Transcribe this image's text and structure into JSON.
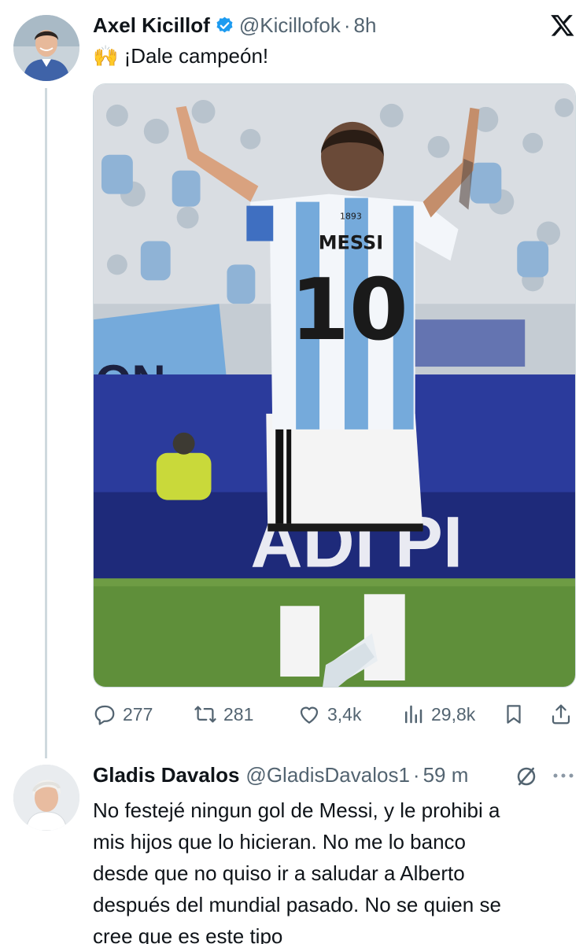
{
  "tweet": {
    "author_name": "Axel Kicillof",
    "author_handle": "@Kicillofok",
    "separator": "·",
    "time": "8h",
    "emoji": "🙌",
    "text": "¡Dale campeón!",
    "media": {
      "jersey_name": "MESSI",
      "jersey_number": "10",
      "jersey_year": "1893",
      "banner_text": "ON",
      "board_text": "ADI PI",
      "colors": {
        "sky_blue": "#75aadb",
        "pitch_green": "#5f8f3a",
        "board_blue": "#2b3b9c"
      }
    },
    "actions": {
      "replies": "277",
      "reposts": "281",
      "likes": "3,4k",
      "views": "29,8k"
    }
  },
  "reply": {
    "author_name": "Gladis Davalos",
    "author_handle": "@GladisDavalos1",
    "separator": "·",
    "time": "59 m",
    "lines": [
      "No festejé ningun gol de Messi, y le prohibi a",
      "mis hijos que lo hicieran. No me lo banco",
      "desde que no quiso ir a saludar a Alberto",
      "después del mundial pasado. No se quien se",
      "cree que es este tipo"
    ]
  },
  "icons": {
    "verified": "verified-badge-icon",
    "x_logo": "x-logo-icon",
    "reply": "speech-bubble-icon",
    "repost": "repost-arrows-icon",
    "like": "heart-icon",
    "views": "bar-chart-icon",
    "bookmark": "bookmark-icon",
    "share": "share-upload-icon",
    "mute": "circle-slash-icon",
    "more": "ellipsis-icon"
  },
  "colors": {
    "text": "#0f1419",
    "secondary": "#536471",
    "verified": "#1d9bf0",
    "line": "#cfd9de"
  }
}
